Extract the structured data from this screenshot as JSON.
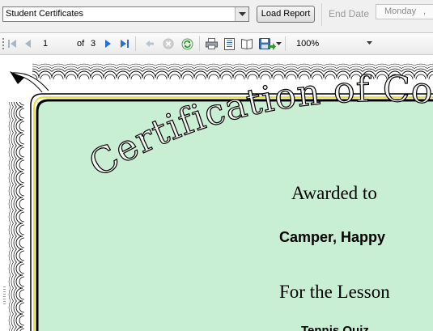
{
  "topbar": {
    "report_select": "Student Certificates",
    "load_button": "Load Report",
    "end_date_label": "End Date",
    "end_date_value": "Monday",
    "end_date_sep": ","
  },
  "toolbar": {
    "page_current": "1",
    "page_of": "of",
    "page_total": "3",
    "zoom": "100%",
    "icons": [
      "first-page-icon",
      "prev-page-icon",
      "next-page-icon",
      "last-page-icon",
      "back-icon",
      "stop-icon",
      "refresh-icon",
      "print-icon",
      "print-layout-icon",
      "page-setup-icon",
      "export-icon"
    ]
  },
  "certificate": {
    "title": "Certification of Co",
    "awarded_label": "Awarded to",
    "recipient": "Camper, Happy",
    "lesson_label": "For the Lesson",
    "lesson": "Tennis Quiz",
    "colors": {
      "background": "#c8efd4",
      "border": "#000000",
      "accent": "#e8e040"
    }
  }
}
